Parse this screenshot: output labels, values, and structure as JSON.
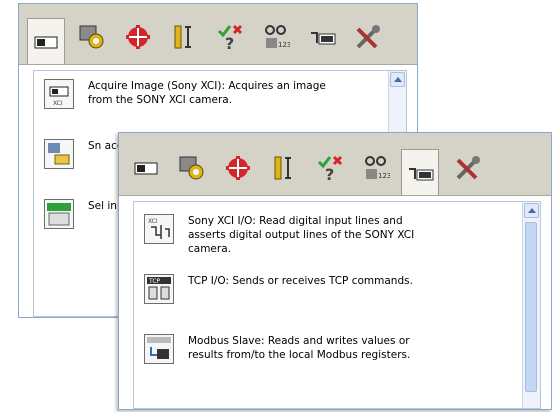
{
  "back_panel": {
    "tabs": [
      "camera-tab-icon",
      "vision-tab-icon",
      "target-tab-icon",
      "measure-tab-icon",
      "check-tab-icon",
      "glasses-tab-icon",
      "io-tab-icon",
      "tools-tab-icon"
    ],
    "items": [
      {
        "icon": "camera-icon",
        "text": "Acquire Image (Sony XCI):  Acquires an image from the SONY XCI camera."
      },
      {
        "icon": "image-folder-icon",
        "text": "Sn acc fro"
      },
      {
        "icon": "select-grid-icon",
        "text": "Sel inp"
      }
    ]
  },
  "front_panel": {
    "tabs": [
      "camera-tab-icon",
      "vision-tab-icon",
      "target-tab-icon",
      "measure-tab-icon",
      "check-tab-icon",
      "glasses-tab-icon",
      "io-tab-icon",
      "tools-tab-icon"
    ],
    "active_tab": "io-tab-icon",
    "items": [
      {
        "icon": "io-lines-icon",
        "text": "Sony XCI I/O:  Read digital input lines and asserts digital output lines of the SONY XCI camera."
      },
      {
        "icon": "tcp-icon",
        "text": "TCP I/O:  Sends or receives TCP commands."
      },
      {
        "icon": "modbus-icon",
        "text": "Modbus Slave:  Reads and writes values or results from/to the local Modbus registers."
      }
    ]
  },
  "colors": {
    "tabbar": "#d5d2c8",
    "accent": "#3a6ab8",
    "red": "#d3262b",
    "green": "#2fa13b"
  }
}
